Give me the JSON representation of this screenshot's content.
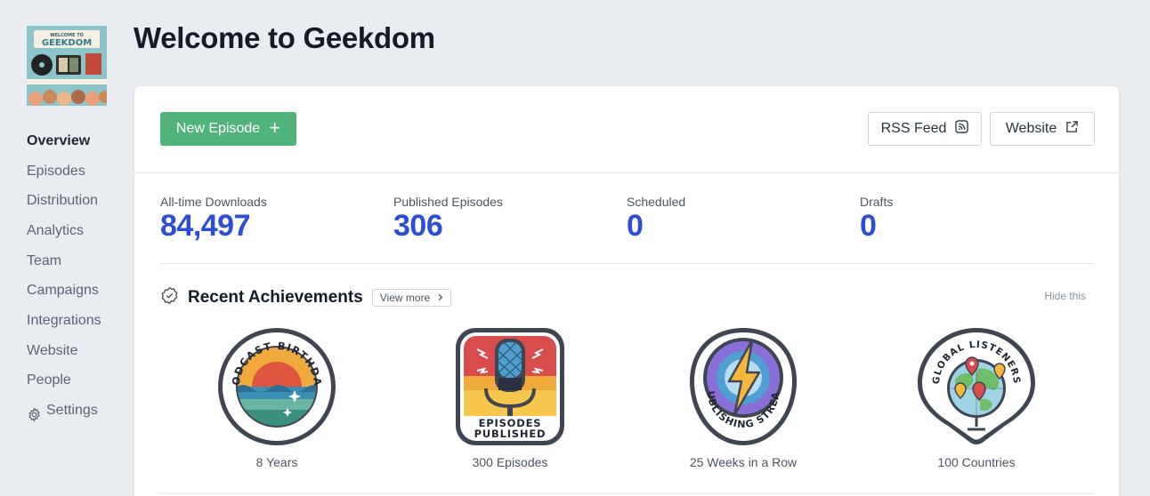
{
  "app": {
    "logo_text_top": "WELCOME TO",
    "logo_text_main": "GEEKDOM"
  },
  "sidebar": {
    "items": [
      {
        "label": "Overview",
        "active": true
      },
      {
        "label": "Episodes"
      },
      {
        "label": "Distribution"
      },
      {
        "label": "Analytics"
      },
      {
        "label": "Team"
      },
      {
        "label": "Campaigns"
      },
      {
        "label": "Integrations"
      },
      {
        "label": "Website"
      },
      {
        "label": "People"
      },
      {
        "label": "Settings",
        "icon": "gear-icon"
      }
    ]
  },
  "header": {
    "title": "Welcome to Geekdom"
  },
  "toolbar": {
    "new_episode_label": "New Episode",
    "rss_label": "RSS Feed",
    "website_label": "Website"
  },
  "stats": [
    {
      "label": "All-time Downloads",
      "value": "84,497"
    },
    {
      "label": "Published Episodes",
      "value": "306"
    },
    {
      "label": "Scheduled",
      "value": "0"
    },
    {
      "label": "Drafts",
      "value": "0"
    }
  ],
  "achievements": {
    "title": "Recent Achievements",
    "view_more": "View more",
    "hide": "Hide this",
    "badges": [
      {
        "name": "PODCAST BIRTHDAY",
        "label": "8 Years"
      },
      {
        "name": "EPISODES PUBLISHED",
        "label": "300 Episodes"
      },
      {
        "name": "PUBLISHING STREAK",
        "label": "25 Weeks in a Row"
      },
      {
        "name": "GLOBAL LISTENERS",
        "label": "100 Countries"
      }
    ]
  },
  "colors": {
    "accent_green": "#4fb37a",
    "stat_blue": "#2a4fd6",
    "background": "#e9ecf1"
  }
}
